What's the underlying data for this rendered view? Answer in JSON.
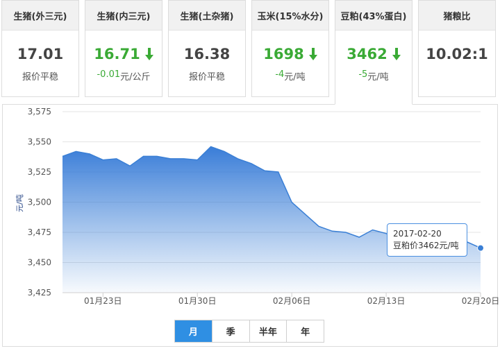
{
  "cards": [
    {
      "title": "生猪(外三元)",
      "value": "17.01",
      "trend": "flat",
      "change": "",
      "sub": "报价平稳"
    },
    {
      "title": "生猪(内三元)",
      "value": "16.71",
      "trend": "down",
      "change": "-0.01",
      "sub": "元/公斤"
    },
    {
      "title": "生猪(土杂猪)",
      "value": "16.38",
      "trend": "flat",
      "change": "",
      "sub": "报价平稳"
    },
    {
      "title": "玉米(15%水分)",
      "value": "1698",
      "trend": "down",
      "change": "-4",
      "sub": "元/吨"
    },
    {
      "title": "豆粕(43%蛋白)",
      "value": "3462",
      "trend": "down",
      "change": "-5",
      "sub": "元/吨"
    },
    {
      "title": "猪粮比",
      "value": "10.02:1",
      "trend": "flat",
      "change": "",
      "sub": ""
    }
  ],
  "active_card": 4,
  "colors": {
    "up_down_green": "#3aaa35",
    "series": "#3a7fd5",
    "accent": "#2f8fe3"
  },
  "chart_data": {
    "type": "area",
    "ylabel": "元/吨",
    "ylim": [
      3425,
      3575
    ],
    "yticks": [
      "3,575",
      "3,550",
      "3,525",
      "3,500",
      "3,475",
      "3,450",
      "3,425"
    ],
    "xlim": [
      "2017-01-20",
      "2017-02-20"
    ],
    "xticks": [
      {
        "date": "2017-01-23",
        "label": "01月23日"
      },
      {
        "date": "2017-01-30",
        "label": "01月30日"
      },
      {
        "date": "2017-02-06",
        "label": "02月06日"
      },
      {
        "date": "2017-02-13",
        "label": "02月13日"
      },
      {
        "date": "2017-02-20",
        "label": "02月20日"
      }
    ],
    "grid": true,
    "series": [
      {
        "name": "豆粕价",
        "x": [
          "2017-01-20",
          "2017-01-21",
          "2017-01-22",
          "2017-01-23",
          "2017-01-24",
          "2017-01-25",
          "2017-01-26",
          "2017-01-27",
          "2017-01-28",
          "2017-01-29",
          "2017-01-30",
          "2017-01-31",
          "2017-02-01",
          "2017-02-02",
          "2017-02-03",
          "2017-02-04",
          "2017-02-05",
          "2017-02-06",
          "2017-02-07",
          "2017-02-08",
          "2017-02-09",
          "2017-02-10",
          "2017-02-11",
          "2017-02-12",
          "2017-02-13",
          "2017-02-14",
          "2017-02-15",
          "2017-02-16",
          "2017-02-17",
          "2017-02-18",
          "2017-02-19",
          "2017-02-20"
        ],
        "values": [
          3538,
          3542,
          3540,
          3535,
          3536,
          3530,
          3538,
          3538,
          3536,
          3536,
          3535,
          3546,
          3542,
          3536,
          3532,
          3526,
          3525,
          3500,
          3490,
          3480,
          3476,
          3475,
          3471,
          3477,
          3474,
          3469,
          3471,
          3470,
          3468,
          3469,
          3467,
          3462
        ]
      }
    ],
    "tooltip": {
      "date": "2017-02-20",
      "series": "豆粕价",
      "value": "3462",
      "unit": "元/吨",
      "label_date": "2017-02-20",
      "label_value": "豆粕价3462元/吨"
    }
  },
  "range_buttons": [
    "月",
    "季",
    "半年",
    "年"
  ],
  "active_range": 0
}
